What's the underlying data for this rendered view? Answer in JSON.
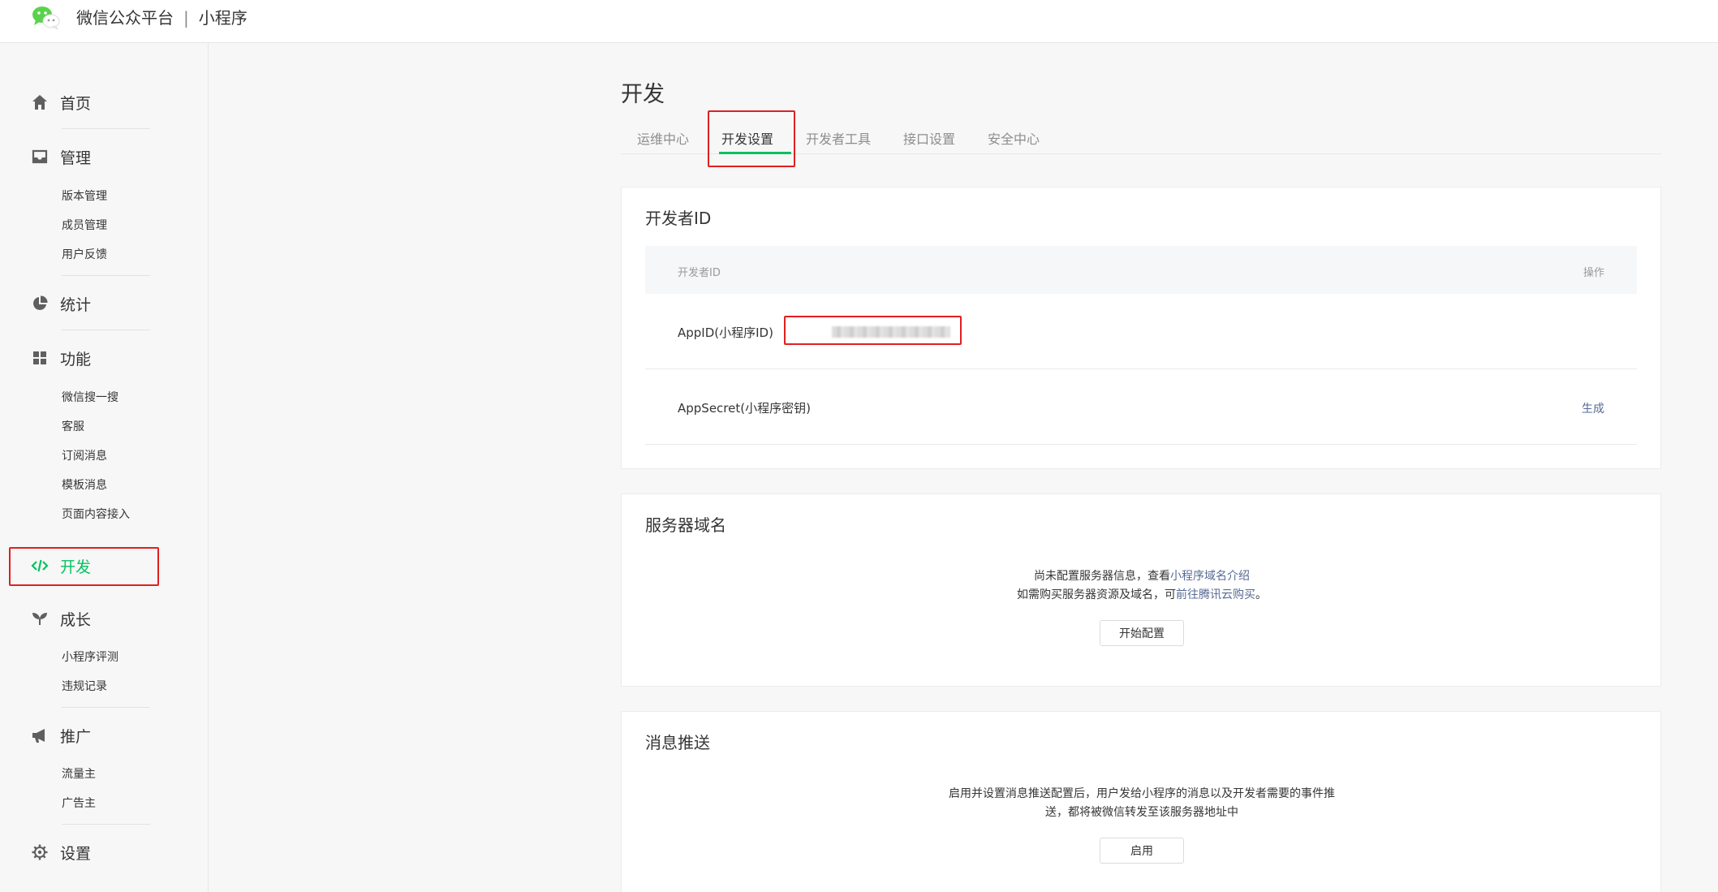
{
  "header": {
    "brand": "微信公众平台",
    "separator": "|",
    "product": "小程序"
  },
  "sidebar": {
    "home": "首页",
    "manage": "管理",
    "manage_items": [
      "版本管理",
      "成员管理",
      "用户反馈"
    ],
    "stats": "统计",
    "features": "功能",
    "features_items": [
      "微信搜一搜",
      "客服",
      "订阅消息",
      "模板消息",
      "页面内容接入"
    ],
    "develop": "开发",
    "growth": "成长",
    "growth_items": [
      "小程序评测",
      "违规记录"
    ],
    "promote": "推广",
    "promote_items": [
      "流量主",
      "广告主"
    ],
    "settings": "设置"
  },
  "main": {
    "title": "开发",
    "tabs": [
      "运维中心",
      "开发设置",
      "开发者工具",
      "接口设置",
      "安全中心"
    ],
    "active_tab": "开发设置",
    "developer_id": {
      "title": "开发者ID",
      "columns": [
        "开发者ID",
        "操作"
      ],
      "rows": [
        {
          "label": "AppID(小程序ID)",
          "value_masked": true
        },
        {
          "label": "AppSecret(小程序密钥)",
          "action": "生成"
        }
      ]
    },
    "server_domain": {
      "title": "服务器域名",
      "line1_prefix": "尚未配置服务器信息，查看",
      "line1_link": "小程序域名介绍",
      "line2_prefix": "如需购买服务器资源及域名，可",
      "line2_link": "前往腾讯云购买",
      "line2_suffix": "。",
      "button": "开始配置"
    },
    "message_push": {
      "title": "消息推送",
      "line1": "启用并设置消息推送配置后，用户发给小程序的消息以及开发者需要的事件推",
      "line2": "送，都将被微信转发至该服务器地址中",
      "button": "启用"
    }
  },
  "colors": {
    "accent": "#07c160",
    "link": "#576b95",
    "highlight": "#e02020"
  }
}
